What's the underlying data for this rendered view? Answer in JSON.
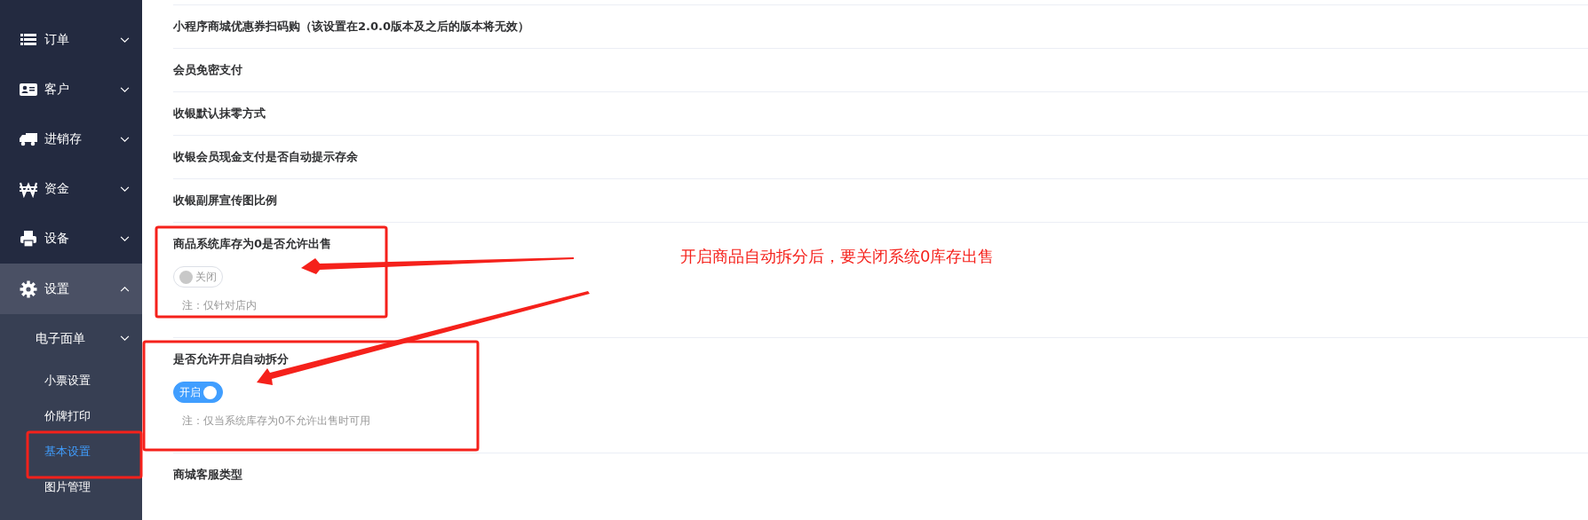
{
  "sidebar": {
    "items": [
      {
        "label": "订单",
        "expanded": false
      },
      {
        "label": "客户",
        "expanded": false
      },
      {
        "label": "进销存",
        "expanded": false
      },
      {
        "label": "资金",
        "expanded": false
      },
      {
        "label": "设备",
        "expanded": false
      },
      {
        "label": "设置",
        "expanded": true,
        "children": [
          {
            "label": "电子面单",
            "kind": "group"
          },
          {
            "label": "小票设置",
            "kind": "link",
            "selected": false
          },
          {
            "label": "价牌打印",
            "kind": "link",
            "selected": false
          },
          {
            "label": "基本设置",
            "kind": "link",
            "selected": true
          },
          {
            "label": "图片管理",
            "kind": "link",
            "selected": false
          }
        ]
      }
    ]
  },
  "settings": [
    {
      "kind": "plain",
      "title": "小程序商城优惠券扫码购（该设置在2.0.0版本及之后的版本将无效）"
    },
    {
      "kind": "plain",
      "title": "会员免密支付"
    },
    {
      "kind": "plain",
      "title": "收银默认抹零方式"
    },
    {
      "kind": "plain",
      "title": "收银会员现金支付是否自动提示存余"
    },
    {
      "kind": "plain",
      "title": "收银副屏宣传图比例"
    },
    {
      "kind": "toggle",
      "title": "商品系统库存为0是否允许出售",
      "on": false,
      "switch_label": "关闭",
      "note": "注：仅针对店内"
    },
    {
      "kind": "toggle",
      "title": "是否允许开启自动拆分",
      "on": true,
      "switch_label": "开启",
      "note": "注：仅当系统库存为0不允许出售时可用"
    },
    {
      "kind": "plain",
      "title": "商城客服类型"
    }
  ],
  "annotation": {
    "text": "开启商品自动拆分后，要关闭系统0库存出售"
  }
}
